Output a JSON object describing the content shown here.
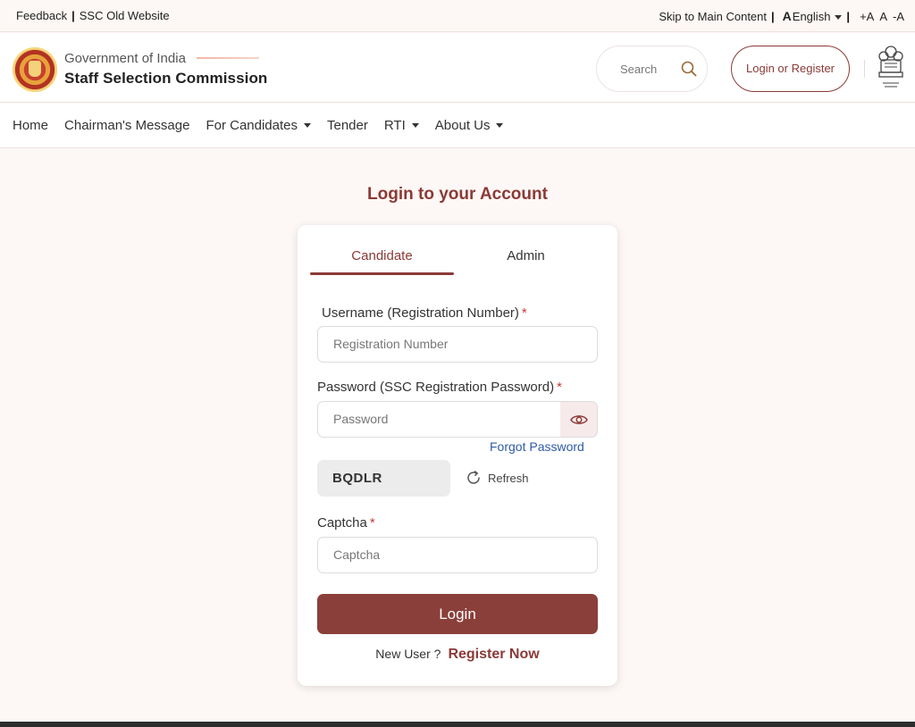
{
  "topbar": {
    "feedback": "Feedback",
    "sep": "|",
    "old_website": "SSC Old Website",
    "skip": "Skip to Main Content",
    "lang_icon": "A",
    "language": "English",
    "font_increase": "+A",
    "font_normal": "A",
    "font_decrease": "-A"
  },
  "header": {
    "gov": "Government of India",
    "org": "Staff Selection Commission",
    "search_placeholder": "Search",
    "login_register": "Login or Register"
  },
  "nav": {
    "items": [
      "Home",
      "Chairman's Message",
      "For Candidates",
      "Tender",
      "RTI",
      "About Us"
    ]
  },
  "login": {
    "title": "Login to your Account",
    "tabs": [
      "Candidate",
      "Admin"
    ],
    "username_label": "Username (Registration Number)",
    "username_placeholder": "Registration Number",
    "password_label": "Password (SSC Registration Password)",
    "password_placeholder": "Password",
    "forgot": "Forgot Password",
    "captcha_code": "BQDLR",
    "refresh": "Refresh",
    "captcha_label": "Captcha",
    "captcha_placeholder": "Captcha",
    "required_mark": "*",
    "submit": "Login",
    "new_user": "New User ?",
    "register": "Register Now"
  },
  "colors": {
    "brand": "#8b3a36",
    "link": "#2f5aa8",
    "background": "#fdf7f5"
  },
  "icons": [
    "search-icon",
    "eye-icon",
    "refresh-icon",
    "language-icon",
    "caret-down-icon",
    "ssc-logo",
    "national-emblem"
  ]
}
